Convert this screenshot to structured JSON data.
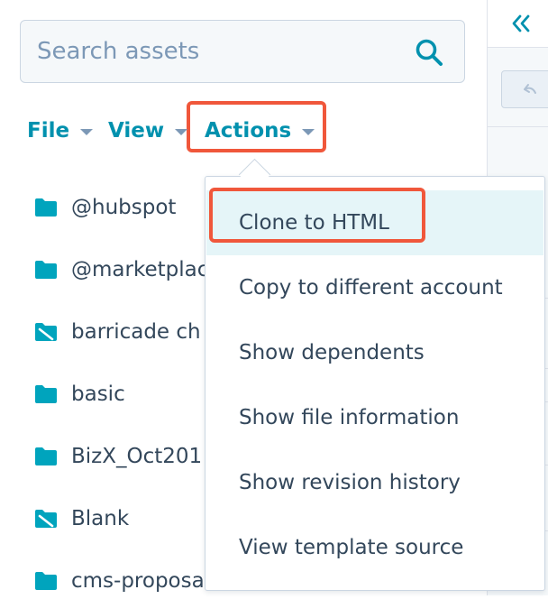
{
  "colors": {
    "accent": "#0091ae",
    "highlight": "#f0573b",
    "text": "#33475b",
    "muted": "#7c98b6",
    "folder": "#00a4bd"
  },
  "search": {
    "placeholder": "Search assets",
    "icon": "search-icon"
  },
  "menubar": {
    "file_label": "File",
    "view_label": "View",
    "actions_label": "Actions"
  },
  "tree": {
    "items": [
      {
        "label": "@hubspot",
        "icon": "folder-icon"
      },
      {
        "label": "@marketplace",
        "icon": "folder-icon"
      },
      {
        "label": "barricade ch",
        "icon": "folder-hidden-icon"
      },
      {
        "label": "basic",
        "icon": "folder-icon"
      },
      {
        "label": "BizX_Oct201",
        "icon": "folder-icon"
      },
      {
        "label": "Blank",
        "icon": "folder-hidden-icon"
      },
      {
        "label": "cms-proposa",
        "icon": "folder-icon"
      }
    ]
  },
  "actions_menu": {
    "items": [
      {
        "label": "Clone to HTML"
      },
      {
        "label": "Copy to different account"
      },
      {
        "label": "Show dependents"
      },
      {
        "label": "Show file information"
      },
      {
        "label": "Show revision history"
      },
      {
        "label": "View template source"
      }
    ]
  },
  "right_panel": {
    "collapse_icon": "double-chevron-left-icon",
    "undo_icon": "undo-icon"
  }
}
